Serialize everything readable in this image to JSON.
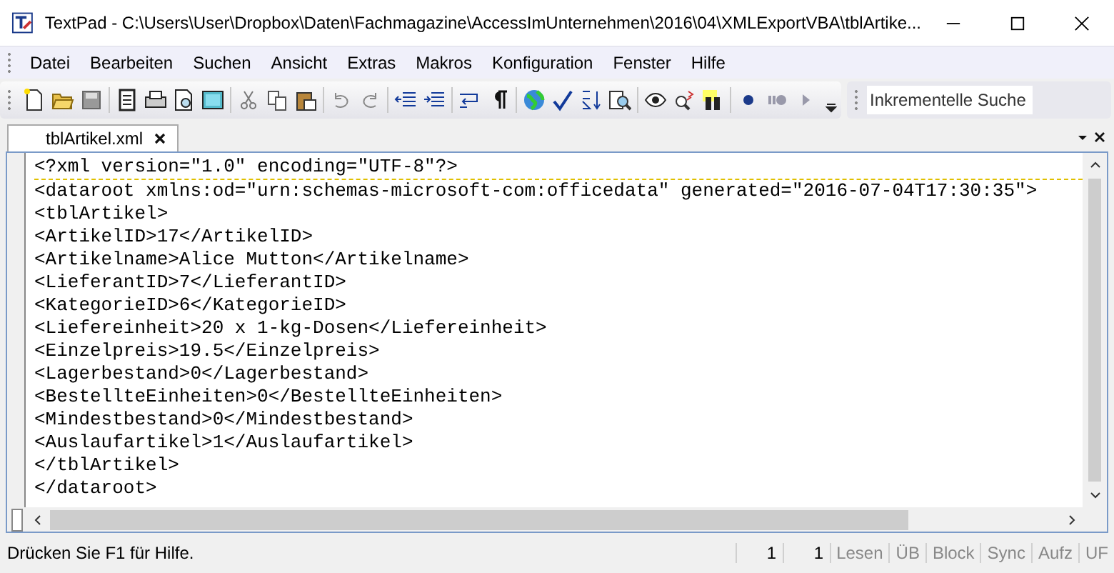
{
  "window": {
    "title": "TextPad - C:\\Users\\User\\Dropbox\\Daten\\Fachmagazine\\AccessImUnternehmen\\2016\\04\\XMLExportVBA\\tblArtike..."
  },
  "menu": [
    "Datei",
    "Bearbeiten",
    "Suchen",
    "Ansicht",
    "Extras",
    "Makros",
    "Konfiguration",
    "Fenster",
    "Hilfe"
  ],
  "search": {
    "placeholder": "Inkrementelle Suche"
  },
  "tabs": [
    {
      "label": "tblArtikel.xml",
      "selected": true
    }
  ],
  "editor": {
    "lines": [
      "<?xml version=\"1.0\" encoding=\"UTF-8\"?>",
      "<dataroot xmlns:od=\"urn:schemas-microsoft-com:officedata\" generated=\"2016-07-04T17:30:35\">",
      "<tblArtikel>",
      "<ArtikelID>17</ArtikelID>",
      "<Artikelname>Alice Mutton</Artikelname>",
      "<LieferantID>7</LieferantID>",
      "<KategorieID>6</KategorieID>",
      "<Liefereinheit>20 x 1-kg-Dosen</Liefereinheit>",
      "<Einzelpreis>19.5</Einzelpreis>",
      "<Lagerbestand>0</Lagerbestand>",
      "<BestellteEinheiten>0</BestellteEinheiten>",
      "<Mindestbestand>0</Mindestbestand>",
      "<Auslaufartikel>1</Auslaufartikel>",
      "</tblArtikel>",
      "</dataroot>"
    ]
  },
  "status_bar": {
    "message": "Drücken Sie F1 für Hilfe.",
    "panes": [
      {
        "text": "1",
        "kind": "value",
        "active": true
      },
      {
        "text": "1",
        "kind": "value",
        "active": true
      },
      {
        "text": "Lesen",
        "kind": "indicator",
        "active": false
      },
      {
        "text": "ÜB",
        "kind": "indicator",
        "active": false
      },
      {
        "text": "Block",
        "kind": "indicator",
        "active": false
      },
      {
        "text": "Sync",
        "kind": "indicator",
        "active": false
      },
      {
        "text": "Aufz",
        "kind": "indicator",
        "active": false
      },
      {
        "text": "UF",
        "kind": "indicator",
        "active": false
      }
    ]
  }
}
